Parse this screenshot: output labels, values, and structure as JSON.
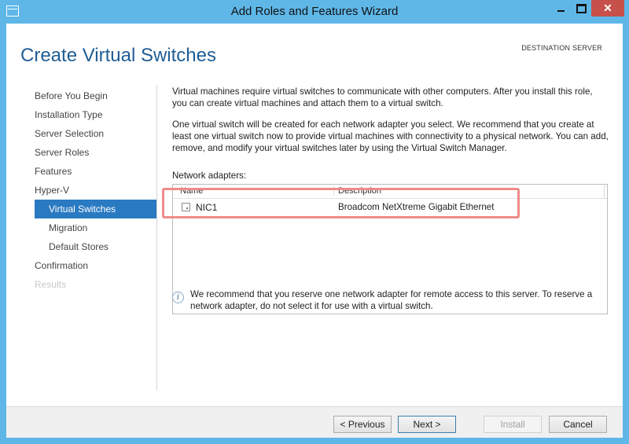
{
  "window": {
    "title": "Add Roles and Features Wizard",
    "controls": {
      "minimize": "",
      "maximize": "",
      "close": "✕"
    }
  },
  "header": {
    "page_title": "Create Virtual Switches",
    "destination_label": "DESTINATION SERVER"
  },
  "nav": {
    "items": [
      {
        "label": "Before You Begin",
        "state": "normal"
      },
      {
        "label": "Installation Type",
        "state": "normal"
      },
      {
        "label": "Server Selection",
        "state": "normal"
      },
      {
        "label": "Server Roles",
        "state": "normal"
      },
      {
        "label": "Features",
        "state": "normal"
      },
      {
        "label": "Hyper-V",
        "state": "normal"
      },
      {
        "label": "Virtual Switches",
        "state": "selected"
      },
      {
        "label": "Migration",
        "state": "normal"
      },
      {
        "label": "Default Stores",
        "state": "normal"
      },
      {
        "label": "Confirmation",
        "state": "normal"
      },
      {
        "label": "Results",
        "state": "disabled"
      }
    ]
  },
  "content": {
    "para1": "Virtual machines require virtual switches to communicate with other computers. After you install this role, you can create virtual machines and attach them to a virtual switch.",
    "para2": "One virtual switch will be created for each network adapter you select. We recommend that you create at least one virtual switch now to provide virtual machines with connectivity to a physical network. You can add, remove, and modify your virtual switches later by using the Virtual Switch Manager.",
    "adapters_label": "Network adapters:",
    "table": {
      "columns": [
        "Name",
        "Description"
      ],
      "rows": [
        {
          "checked": false,
          "name": "NIC1",
          "description": "Broadcom NetXtreme Gigabit Ethernet"
        }
      ]
    },
    "info_icon": "i",
    "info_text": "We recommend that you reserve one network adapter for remote access to this server. To reserve a network adapter, do not select it for use with a virtual switch."
  },
  "footer": {
    "previous": "< Previous",
    "next": "Next >",
    "install": "Install",
    "cancel": "Cancel"
  },
  "colors": {
    "titlebar": "#5fb7e8",
    "title_text": "#1f5d94",
    "nav_selected": "#2a7ac2",
    "close_button": "#c7504a",
    "highlight": "#f08a8a"
  }
}
